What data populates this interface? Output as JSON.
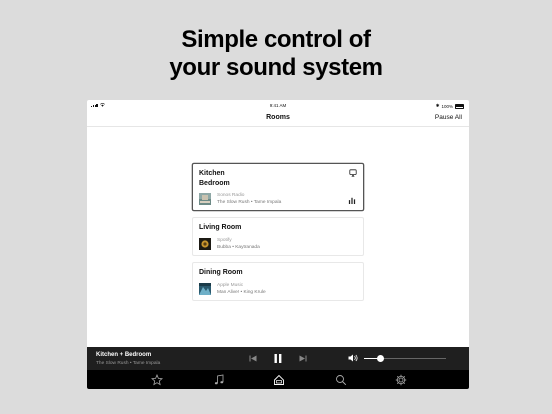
{
  "headline": {
    "line1": "Simple control of",
    "line2": "your sound system"
  },
  "statusbar": {
    "time": "9:41 AM",
    "battery": "100%",
    "bluetooth": "✱"
  },
  "navbar": {
    "title": "Rooms",
    "action": "Pause All"
  },
  "rooms": [
    {
      "name_line1": "Kitchen",
      "name_line2": "Bedroom",
      "service": "Sonos Radio",
      "track": "The Slow Rush • Tame Impala",
      "selected": true,
      "icon_top": "airplay-icon",
      "icon_bottom": "equalizer-icon"
    },
    {
      "name_line1": "Living Room",
      "service": "Spotify",
      "track": "Bubba • Kaytranada"
    },
    {
      "name_line1": "Dining Room",
      "service": "Apple Music",
      "track": "Man Alive! • King Krule"
    }
  ],
  "player": {
    "title": "Kitchen + Bedroom",
    "track": "The Slow Rush • Tame Impala",
    "volume_percent": 20
  },
  "tabs": [
    "favorites",
    "music",
    "rooms",
    "search",
    "settings"
  ],
  "active_tab": "rooms",
  "colors": {
    "background": "#dcdcdc",
    "player": "#1f1f1f",
    "tabbar": "#000000",
    "selected_border": "#555555"
  }
}
